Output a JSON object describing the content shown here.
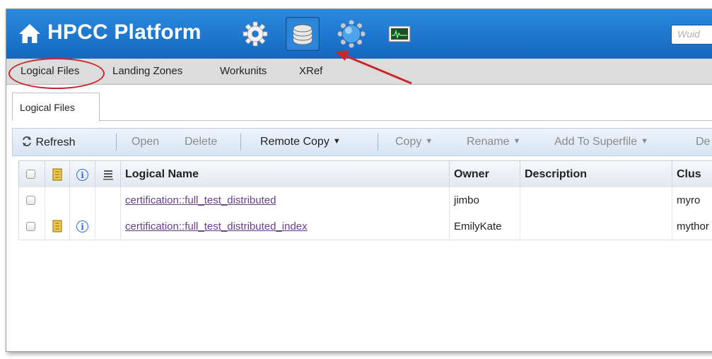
{
  "header": {
    "title": "HPCC Platform",
    "icons": [
      "home-icon",
      "gear-icon",
      "database-icon",
      "globe-icon",
      "monitor-icon"
    ],
    "search_placeholder": "Wuid"
  },
  "subnav": {
    "items": [
      "Logical Files",
      "Landing Zones",
      "Workunits",
      "XRef"
    ],
    "active": "Logical Files"
  },
  "tabs": [
    {
      "label": "Logical Files"
    }
  ],
  "toolbar": {
    "refresh": "Refresh",
    "open": "Open",
    "delete": "Delete",
    "remote_copy": "Remote Copy",
    "copy": "Copy",
    "rename": "Rename",
    "add_to_superfile": "Add To Superfile",
    "overflow": "De"
  },
  "grid": {
    "columns": [
      "Logical Name",
      "Owner",
      "Description",
      "Clus"
    ],
    "rows": [
      {
        "logical_name": "certification::full_test_distributed",
        "owner": "jimbo",
        "description": "",
        "cluster": "myro",
        "has_key_icon": false,
        "has_info_icon": false
      },
      {
        "logical_name": "certification::full_test_distributed_index",
        "owner": "EmilyKate",
        "description": "",
        "cluster": "mythor",
        "has_key_icon": true,
        "has_info_icon": true
      }
    ]
  },
  "colors": {
    "header_blue": "#1d7cd6",
    "annotation_red": "#c8282d",
    "link_purple": "#6a3d8a"
  }
}
